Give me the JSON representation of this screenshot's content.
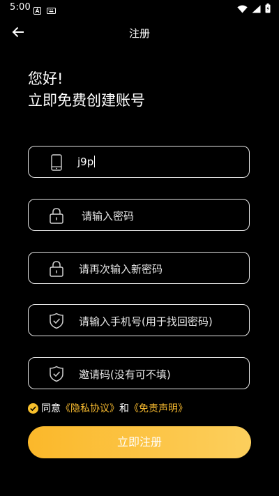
{
  "status_bar": {
    "time": "5:00",
    "left_icons": [
      "notification-a-icon",
      "keyboard-icon"
    ],
    "right_icons": [
      "wifi-icon",
      "signal-icon",
      "battery-icon"
    ]
  },
  "app_bar": {
    "title": "注册",
    "back_icon": "arrow-left-icon"
  },
  "greeting": {
    "line1": "您好!",
    "line2": "立即免费创建账号"
  },
  "form": {
    "phone": {
      "value": "j9p",
      "icon": "phone-icon"
    },
    "password": {
      "placeholder": "请输入密码",
      "icon": "lock-icon"
    },
    "confirm_password": {
      "placeholder": "请再次输入新密码",
      "icon": "lock-icon"
    },
    "recovery_phone": {
      "placeholder": "请输入手机号(用于找回密码)",
      "icon": "shield-check-icon"
    },
    "invite_code": {
      "placeholder": "邀请码(没有可不填)",
      "icon": "shield-check-icon"
    }
  },
  "agreement": {
    "checked": true,
    "prefix": "同意",
    "privacy_link": "《隐私协议》",
    "conjunction": "和",
    "disclaimer_link": "《免责声明》"
  },
  "submit_button": {
    "label": "立即注册"
  },
  "colors": {
    "background": "#000000",
    "accent": "#fbb82a",
    "accent_light": "#fccf5d",
    "link": "#f5b82e",
    "border": "#e6e6e6"
  }
}
